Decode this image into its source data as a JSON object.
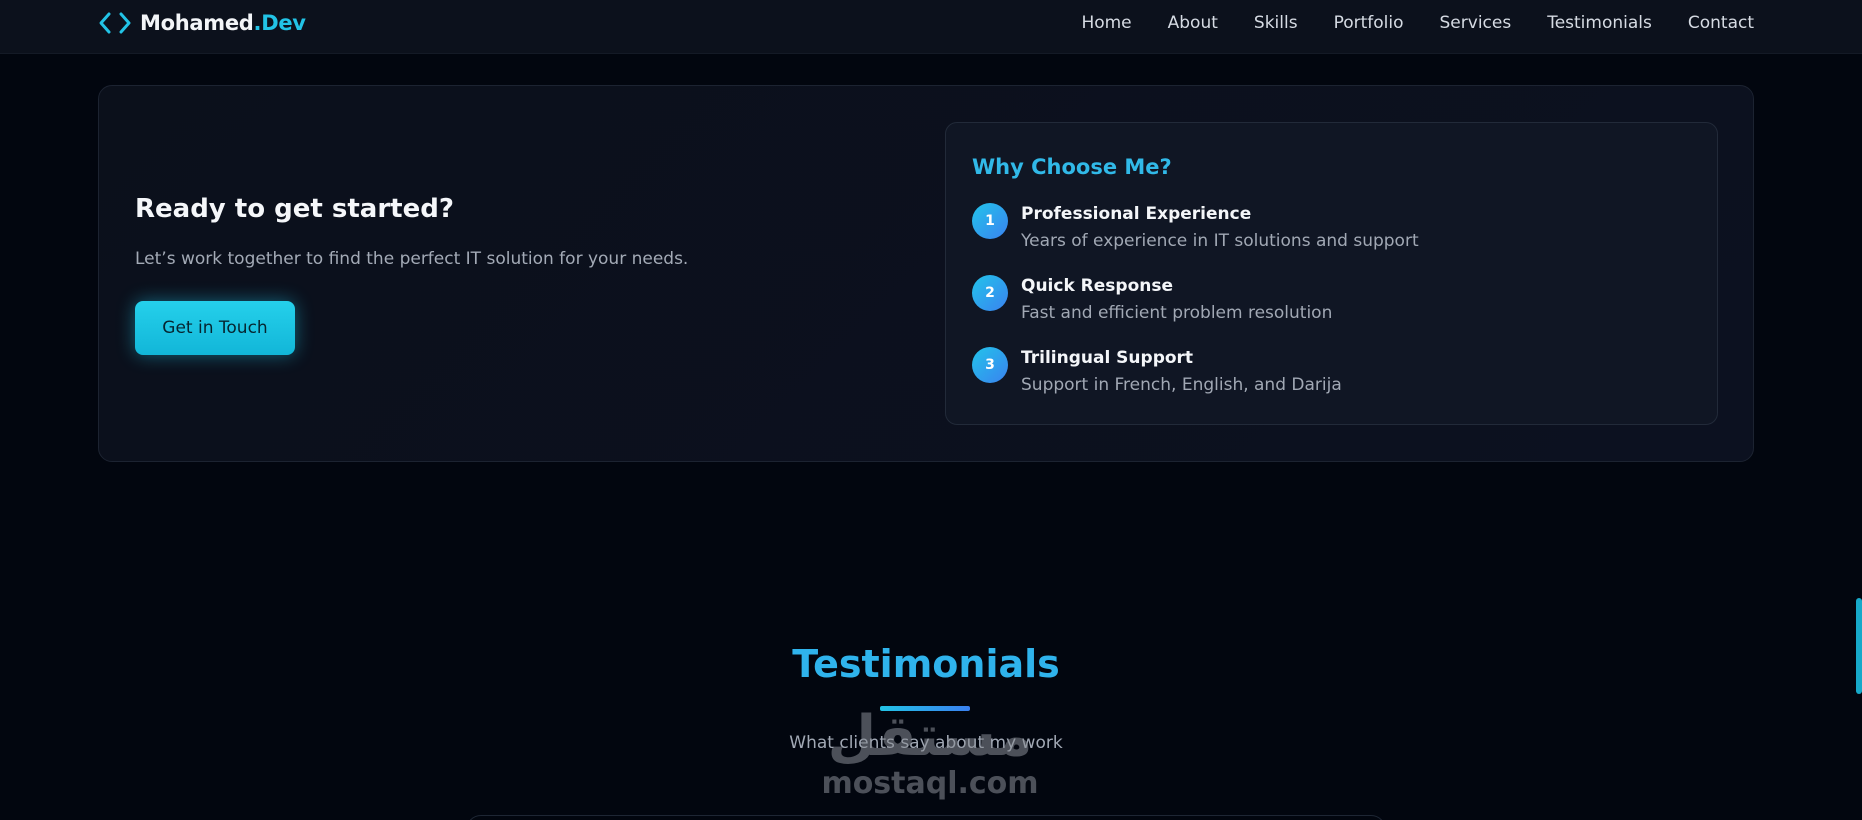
{
  "nav": {
    "logo_icon": "code-brackets-icon",
    "logo_name": "Mohamed",
    "logo_accent": ".Dev",
    "links": [
      "Home",
      "About",
      "Skills",
      "Portfolio",
      "Services",
      "Testimonials",
      "Contact"
    ]
  },
  "cta": {
    "title": "Ready to get started?",
    "subtitle": "Let’s work together to find the perfect IT solution for your needs.",
    "button": "Get in Touch"
  },
  "why": {
    "title": "Why Choose Me?",
    "items": [
      {
        "num": "1",
        "title": "Professional Experience",
        "desc": "Years of experience in IT solutions and support"
      },
      {
        "num": "2",
        "title": "Quick Response",
        "desc": "Fast and efficient problem resolution"
      },
      {
        "num": "3",
        "title": "Trilingual Support",
        "desc": "Support in French, English, and Darija"
      }
    ]
  },
  "testimonials": {
    "title": "Testimonials",
    "subtitle": "What clients say about my work"
  },
  "watermark": {
    "arabic": "مستقل",
    "latin": "mostaql.com"
  },
  "colors": {
    "accent": "#22c3e6",
    "accent_blue": "#3a80f0",
    "background": "#02060f"
  }
}
